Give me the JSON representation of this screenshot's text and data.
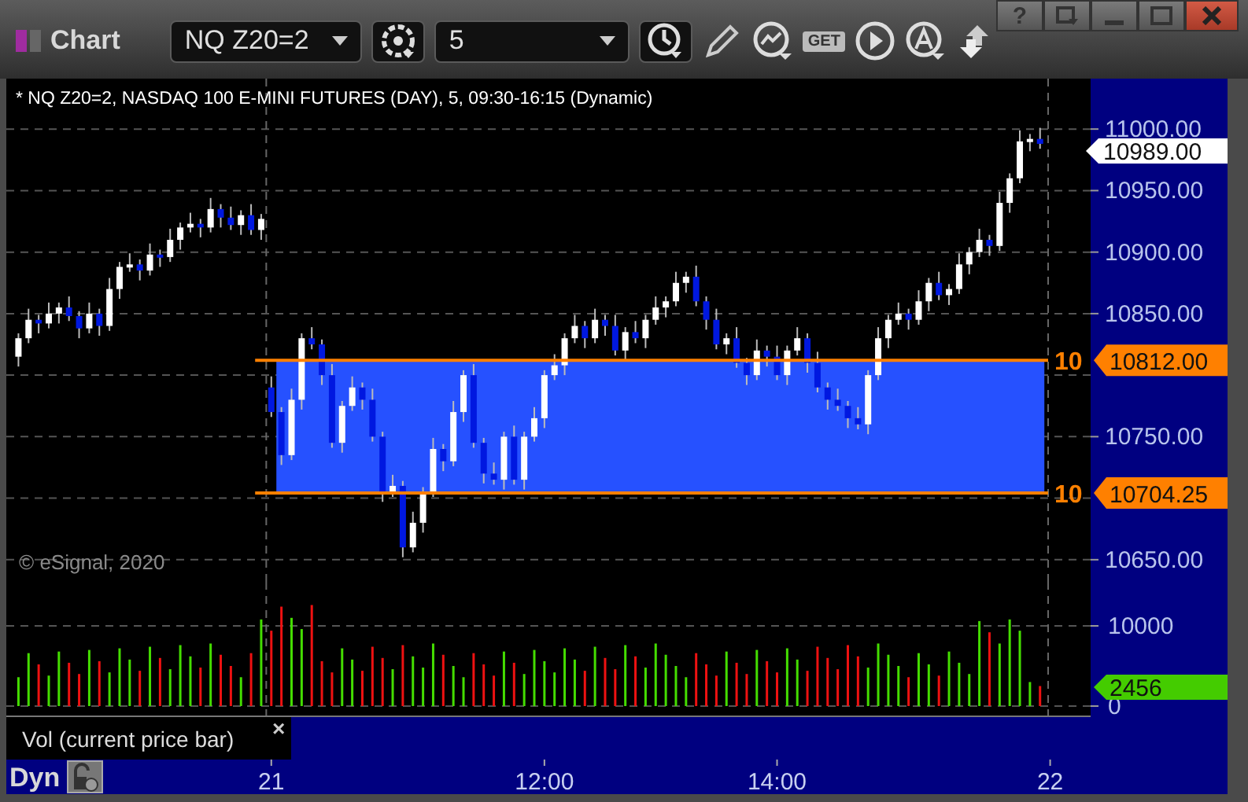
{
  "window": {
    "title": "Chart",
    "help": "?"
  },
  "toolbar": {
    "symbol": "NQ Z20=2",
    "interval": "5",
    "get_label": "GET"
  },
  "chart": {
    "legend": "* NQ Z20=2, NASDAQ 100 E-MINI FUTURES (DAY), 5, 09:30-16:15 (Dynamic)",
    "copyright": "© eSignal, 2020",
    "last_price": "10989.00",
    "levels": [
      {
        "label": "10",
        "price": "10812.00"
      },
      {
        "label": "10",
        "price": "10704.25"
      }
    ],
    "chart_data": {
      "type": "candlestick",
      "grid": true,
      "categories": [
        null,
        null,
        null,
        null,
        null,
        null,
        null,
        null,
        null,
        null,
        null,
        null,
        null,
        null,
        null,
        null,
        null,
        null,
        null,
        null,
        null,
        null,
        null,
        null,
        null,
        null,
        null,
        null,
        null,
        null,
        null,
        null,
        null,
        null,
        null,
        null,
        null,
        null,
        null,
        null,
        null,
        null,
        null,
        null,
        null,
        null,
        null,
        null,
        null,
        null,
        null,
        null,
        null,
        null,
        null,
        null,
        null,
        null,
        null,
        null,
        null,
        null,
        null,
        null,
        null,
        null,
        null,
        null,
        null,
        null,
        null,
        null,
        null,
        null,
        null,
        null,
        null,
        null,
        null,
        null,
        null,
        null,
        null,
        null,
        null,
        null,
        null,
        null,
        null,
        null,
        null,
        null,
        null,
        null,
        null,
        null,
        null,
        null,
        null,
        null,
        null,
        null,
        null
      ],
      "ohlc": [
        [
          10815,
          10834,
          10807,
          10830
        ],
        [
          10830,
          10854,
          10826,
          10845
        ],
        [
          10845,
          10849,
          10834,
          10842
        ],
        [
          10842,
          10859,
          10838,
          10850
        ],
        [
          10850,
          10859,
          10842,
          10855
        ],
        [
          10855,
          10864,
          10844,
          10848
        ],
        [
          10848,
          10852,
          10830,
          10838
        ],
        [
          10838,
          10859,
          10834,
          10850
        ],
        [
          10850,
          10854,
          10832,
          10840
        ],
        [
          10840,
          10879,
          10836,
          10870
        ],
        [
          10870,
          10892,
          10862,
          10888
        ],
        [
          10888,
          10899,
          10884,
          10890
        ],
        [
          10890,
          10894,
          10877,
          10885
        ],
        [
          10885,
          10907,
          10881,
          10898
        ],
        [
          10898,
          10902,
          10888,
          10896
        ],
        [
          10896,
          10919,
          10892,
          10910
        ],
        [
          10910,
          10924,
          10902,
          10920
        ],
        [
          10920,
          10932,
          10916,
          10923
        ],
        [
          10923,
          10927,
          10912,
          10920
        ],
        [
          10920,
          10944,
          10916,
          10935
        ],
        [
          10935,
          10939,
          10920,
          10928
        ],
        [
          10928,
          10937,
          10918,
          10922
        ],
        [
          10922,
          10934,
          10914,
          10930
        ],
        [
          10930,
          10939,
          10914,
          10918
        ],
        [
          10918,
          10931,
          10910,
          10927
        ],
        [
          10790,
          10799,
          10766,
          10770
        ],
        [
          10770,
          10774,
          10727,
          10735
        ],
        [
          10735,
          10789,
          10731,
          10780
        ],
        [
          10780,
          10834,
          10772,
          10830
        ],
        [
          10830,
          10839,
          10821,
          10825
        ],
        [
          10825,
          10829,
          10792,
          10800
        ],
        [
          10800,
          10809,
          10741,
          10745
        ],
        [
          10745,
          10779,
          10737,
          10775
        ],
        [
          10775,
          10799,
          10771,
          10790
        ],
        [
          10790,
          10794,
          10772,
          10780
        ],
        [
          10780,
          10789,
          10746,
          10750
        ],
        [
          10750,
          10754,
          10697,
          10705
        ],
        [
          10705,
          10719,
          10701,
          10710
        ],
        [
          10710,
          10714,
          10652,
          10660
        ],
        [
          10660,
          10689,
          10656,
          10680
        ],
        [
          10680,
          10709,
          10672,
          10705
        ],
        [
          10705,
          10749,
          10701,
          10740
        ],
        [
          10740,
          10744,
          10722,
          10730
        ],
        [
          10730,
          10779,
          10726,
          10770
        ],
        [
          10770,
          10804,
          10762,
          10800
        ],
        [
          10800,
          10809,
          10741,
          10745
        ],
        [
          10745,
          10749,
          10712,
          10720
        ],
        [
          10720,
          10729,
          10711,
          10715
        ],
        [
          10715,
          10754,
          10707,
          10750
        ],
        [
          10750,
          10759,
          10711,
          10715
        ],
        [
          10715,
          10754,
          10707,
          10750
        ],
        [
          10750,
          10774,
          10746,
          10765
        ],
        [
          10765,
          10804,
          10757,
          10800
        ],
        [
          10800,
          10817,
          10796,
          10808
        ],
        [
          10808,
          10834,
          10800,
          10830
        ],
        [
          10830,
          10849,
          10826,
          10840
        ],
        [
          10840,
          10844,
          10822,
          10830
        ],
        [
          10830,
          10854,
          10826,
          10845
        ],
        [
          10845,
          10849,
          10832,
          10840
        ],
        [
          10840,
          10849,
          10816,
          10820
        ],
        [
          10820,
          10839,
          10812,
          10835
        ],
        [
          10835,
          10844,
          10826,
          10830
        ],
        [
          10830,
          10849,
          10822,
          10845
        ],
        [
          10845,
          10864,
          10841,
          10855
        ],
        [
          10855,
          10864,
          10847,
          10860
        ],
        [
          10860,
          10884,
          10856,
          10875
        ],
        [
          10875,
          10884,
          10867,
          10880
        ],
        [
          10880,
          10889,
          10856,
          10860
        ],
        [
          10860,
          10864,
          10837,
          10845
        ],
        [
          10845,
          10854,
          10821,
          10825
        ],
        [
          10825,
          10834,
          10817,
          10830
        ],
        [
          10830,
          10839,
          10806,
          10810
        ],
        [
          10810,
          10814,
          10792,
          10800
        ],
        [
          10800,
          10829,
          10796,
          10820
        ],
        [
          10820,
          10824,
          10807,
          10815
        ],
        [
          10815,
          10824,
          10796,
          10800
        ],
        [
          10800,
          10824,
          10792,
          10820
        ],
        [
          10820,
          10839,
          10816,
          10830
        ],
        [
          10830,
          10834,
          10802,
          10810
        ],
        [
          10810,
          10819,
          10786,
          10790
        ],
        [
          10790,
          10794,
          10772,
          10780
        ],
        [
          10780,
          10789,
          10771,
          10775
        ],
        [
          10775,
          10779,
          10757,
          10765
        ],
        [
          10765,
          10774,
          10756,
          10760
        ],
        [
          10760,
          10804,
          10752,
          10800
        ],
        [
          10800,
          10839,
          10796,
          10830
        ],
        [
          10830,
          10849,
          10822,
          10845
        ],
        [
          10845,
          10859,
          10841,
          10850
        ],
        [
          10850,
          10854,
          10837,
          10845
        ],
        [
          10845,
          10869,
          10841,
          10860
        ],
        [
          10860,
          10879,
          10852,
          10875
        ],
        [
          10875,
          10884,
          10861,
          10865
        ],
        [
          10865,
          10874,
          10857,
          10870
        ],
        [
          10870,
          10899,
          10866,
          10890
        ],
        [
          10890,
          10904,
          10882,
          10900
        ],
        [
          10900,
          10919,
          10896,
          10910
        ],
        [
          10910,
          10914,
          10897,
          10905
        ],
        [
          10905,
          10949,
          10901,
          10940
        ],
        [
          10940,
          10964,
          10932,
          10960
        ],
        [
          10960,
          10999,
          10956,
          10990
        ],
        [
          10990,
          10996,
          10982,
          10992
        ],
        [
          10992,
          11001,
          10984,
          10988
        ],
        null
      ],
      "ylim": [
        10632,
        11041
      ],
      "yticks": [
        {
          "value": 11000,
          "label": "11000.00"
        },
        {
          "value": 10950,
          "label": "10950.00"
        },
        {
          "value": 10900,
          "label": "10900.00"
        },
        {
          "value": 10850,
          "label": "10850.00"
        },
        {
          "value": 10750,
          "label": "10750.00"
        },
        {
          "value": 10650,
          "label": "10650.00"
        }
      ]
    }
  },
  "volume": {
    "title": "Vol (current price bar)",
    "close": "×",
    "last": "2456",
    "chart_data": {
      "type": "bar",
      "grid": true,
      "categories": [
        null,
        null,
        null,
        null,
        null,
        null,
        null,
        null,
        null,
        null,
        null,
        null,
        null,
        null,
        null,
        null,
        null,
        null,
        null,
        null,
        null,
        null,
        null,
        null,
        null,
        "21",
        null,
        null,
        null,
        null,
        null,
        null,
        null,
        null,
        null,
        null,
        null,
        null,
        null,
        null,
        null,
        null,
        null,
        null,
        null,
        null,
        null,
        null,
        null,
        null,
        null,
        null,
        "12:00",
        null,
        null,
        null,
        null,
        null,
        null,
        null,
        null,
        null,
        null,
        null,
        null,
        null,
        null,
        null,
        null,
        null,
        null,
        null,
        null,
        null,
        null,
        "14:00",
        null,
        null,
        null,
        null,
        null,
        null,
        null,
        null,
        null,
        null,
        null,
        null,
        null,
        null,
        null,
        null,
        null,
        null,
        null,
        null,
        null,
        null,
        null,
        null,
        null,
        null,
        "22"
      ],
      "values": [
        3600,
        6600,
        5200,
        3800,
        6800,
        5400,
        4000,
        7000,
        5600,
        4200,
        7200,
        5800,
        4400,
        7400,
        6000,
        4600,
        7600,
        6200,
        4800,
        7800,
        6400,
        5000,
        3600,
        6600,
        10800,
        9400,
        12400,
        11000,
        9600,
        12600,
        5600,
        4200,
        7200,
        5800,
        4400,
        7400,
        6000,
        4600,
        7600,
        6200,
        4800,
        7800,
        6400,
        5000,
        3600,
        6600,
        5200,
        3800,
        6800,
        5400,
        4000,
        7000,
        5600,
        4200,
        7200,
        5800,
        4400,
        7400,
        6000,
        4600,
        7600,
        6200,
        4800,
        7800,
        6400,
        5000,
        3600,
        6600,
        5200,
        3800,
        6800,
        5400,
        4000,
        7000,
        5600,
        4200,
        7200,
        5800,
        4400,
        7400,
        6000,
        4600,
        7600,
        6200,
        4800,
        7800,
        6400,
        5000,
        3600,
        6600,
        5200,
        3800,
        6800,
        5400,
        4000,
        10600,
        9200,
        7800,
        10800,
        9400,
        3000,
        2500,
        null
      ],
      "ylim": [
        -1176,
        15490
      ],
      "yticks": [
        {
          "value": 10000,
          "label": "10000"
        },
        {
          "value": 0,
          "label": "0"
        }
      ]
    }
  },
  "time_axis": {
    "mode": "Dyn"
  }
}
